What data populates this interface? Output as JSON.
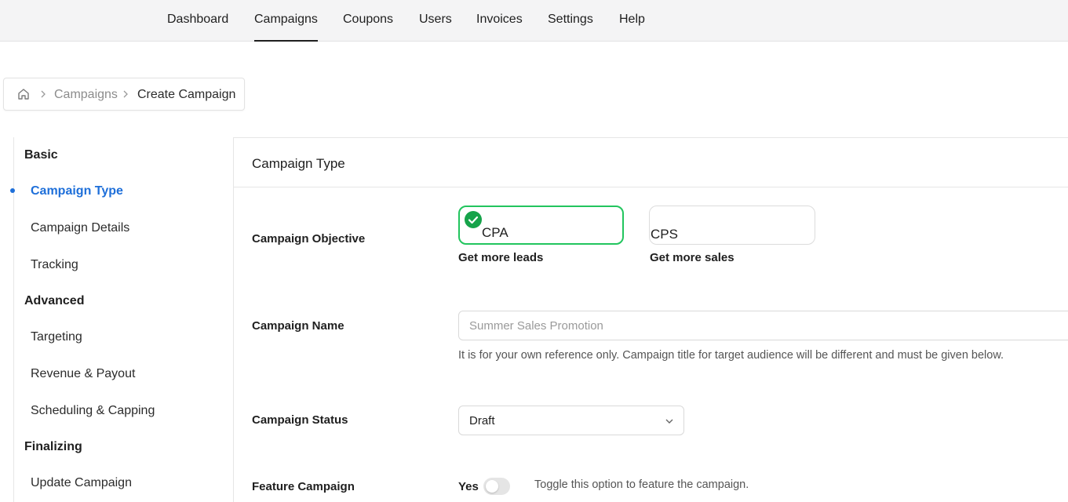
{
  "nav": {
    "items": [
      {
        "label": "Dashboard"
      },
      {
        "label": "Campaigns",
        "active": true
      },
      {
        "label": "Coupons"
      },
      {
        "label": "Users"
      },
      {
        "label": "Invoices"
      },
      {
        "label": "Settings"
      },
      {
        "label": "Help"
      }
    ]
  },
  "breadcrumb": {
    "home_icon": "home-icon",
    "items": [
      "Campaigns",
      "Create Campaign"
    ]
  },
  "sidebar": {
    "groups": [
      {
        "title": "Basic",
        "items": [
          "Campaign Type",
          "Campaign Details",
          "Tracking"
        ]
      },
      {
        "title": "Advanced",
        "items": [
          "Targeting",
          "Revenue & Payout",
          "Scheduling & Capping"
        ]
      },
      {
        "title": "Finalizing",
        "items": [
          "Update Campaign"
        ]
      }
    ],
    "active_item": "Campaign Type"
  },
  "panel": {
    "title": "Campaign Type"
  },
  "form": {
    "objective": {
      "label": "Campaign Objective",
      "options": [
        {
          "name": "CPA",
          "description": "Get more leads",
          "selected": true
        },
        {
          "name": "CPS",
          "description": "Get more sales",
          "selected": false
        }
      ]
    },
    "name": {
      "label": "Campaign Name",
      "value": "",
      "placeholder": "Summer Sales Promotion",
      "help": "It is for your own reference only. Campaign title for target audience will be different and must be given below."
    },
    "status": {
      "label": "Campaign Status",
      "value": "Draft"
    },
    "feature": {
      "label": "Feature Campaign",
      "toggle_label": "Yes",
      "enabled": false,
      "help": "Toggle this option to feature the campaign."
    }
  },
  "colors": {
    "accent": "#1e6fd9",
    "selected_border": "#22c55e",
    "check_badge": "#16a34a"
  }
}
